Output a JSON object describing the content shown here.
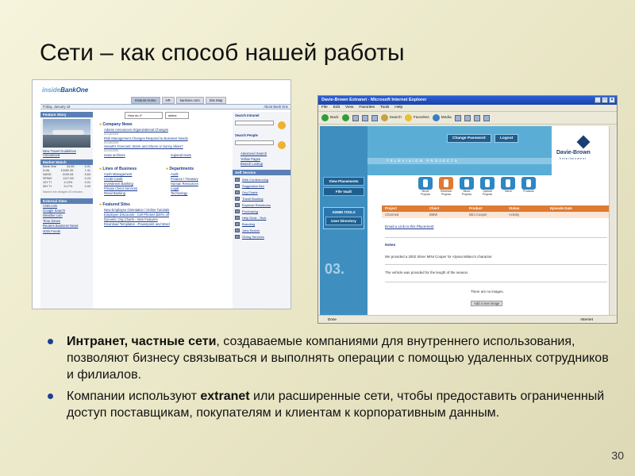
{
  "slide": {
    "title": "Сети – как способ нашей работы",
    "page_number": "30",
    "bullets": [
      {
        "bold": "Интранет, частные сети",
        "text": ", создаваемые компаниями для внутреннего использования,  позволяют бизнесу связываться и выполнять операции с помощью удаленных сотрудников и филиалов."
      },
      {
        "pre": "Компании используют ",
        "bold": "extranet",
        "text": " или расширенные сети, чтобы предоставить ограниченный доступ поставщикам, покупателям и клиентам к корпоративным данным."
      }
    ]
  },
  "intranet": {
    "logo_a": "inside",
    "logo_b": "BankOne",
    "tabs": [
      "Intranet Home",
      "HR",
      "bankone.com",
      "Site Map"
    ],
    "date": "Friday, January 19",
    "about": "About Bank One",
    "feature_story": "Feature Story",
    "feature_caption": "New Travel Guidelines Announced",
    "market_watch": "Market Watch",
    "market": [
      [
        "Bank One",
        "44.55",
        "0.01"
      ],
      [
        "DJIA",
        "10492.39",
        "7.41"
      ],
      [
        "NASD",
        "2100.84",
        "5.63"
      ],
      [
        "SP500",
        "1127.83",
        "0.23"
      ],
      [
        "10Y Tr",
        "4.10%",
        "0.01"
      ],
      [
        "30Y Tr",
        "5.17%",
        "0.00"
      ]
    ],
    "market_note": "Market info delayed 20 minutes",
    "external_sites": "External Sites",
    "external": [
      "CNN.com",
      "Google Search",
      "Weather.com",
      "Time Zones",
      "Reuters Business News",
      "401k Funds"
    ],
    "howdoi": "How do I?",
    "select": "select",
    "company_news": "Company News",
    "news": [
      {
        "t": "Adams Announces Organizational Changes",
        "d": "01/18/2005"
      },
      {
        "t": "Risk Management Changes Respond to Business Needs",
        "d": "01/18/2005"
      },
      {
        "t": "Seowk's Forecast: Storm and Gloom or Sunny Skies?",
        "d": "01/19/2005"
      }
    ],
    "news_archives": "news archives",
    "regional_news": "regional news",
    "lines_of_business": "Lines of Business",
    "lob": [
      "Cash Management",
      "Credit Cards",
      "Investment Banking",
      "Private Client Services",
      "Retail Banking"
    ],
    "departments": "Departments",
    "depts": [
      "Audit",
      "Finance / Treasury",
      "Human Resources",
      "Legal",
      "Technology"
    ],
    "featured_sites": "Featured Sites",
    "featured": [
      "New Employee Orientation / Online Tutorials",
      "Employee Discounts - Cell Phones $20% off",
      "Dynamic Org Charts - New Features",
      "Download Templates - Powerpoint and Word"
    ],
    "search_intranet": "Search Intranet",
    "search_people": "Search People",
    "people_links": [
      "Advanced Search",
      "Yellow Pages",
      "Branch Lookup"
    ],
    "self_service": "Self Service",
    "self": [
      "Web Conferencing",
      "Suggestion Box",
      "Org Charts",
      "Travel Booking",
      "Expense Reimburse",
      "Purchasing",
      "Help Desk - Tech",
      "Branding",
      "Jobs Search",
      "Giving Services"
    ]
  },
  "extranet": {
    "window_title": "Davie-Brown Extranet - Microsoft Internet Explorer",
    "menu": [
      "File",
      "Edit",
      "View",
      "Favorites",
      "Tools",
      "Help"
    ],
    "toolbar": [
      "Back",
      "Search",
      "Favorites",
      "Media"
    ],
    "change_password": "Change Password",
    "logout": "Logout",
    "brand": "Davie-Brown",
    "brand_sub": "entertainment",
    "track_text": "TELEVISION PROJECTS",
    "view_placements": "View Placements",
    "file_vault": "File Vault",
    "admin_tools": "ADMIN TOOLS",
    "user_directory": "User Directory",
    "big_number": "03.",
    "categories": [
      "Movie Projects",
      "Television Projects",
      "Music Projects",
      "Special Projects",
      "Talent",
      "Products"
    ],
    "columns": [
      "Project",
      "Client",
      "Product",
      "Status",
      "Episode Date"
    ],
    "row": [
      "Charmed",
      "BMW",
      "Mini Cooper",
      "Activity",
      ""
    ],
    "email_link": "Email a Link to this Placement",
    "notes_label": "Notes",
    "note1": "We provided a 2002 Silver MINI Cooper for Alyssa Milano's character.",
    "note2": "The vehicle was provided for the length of the season.",
    "no_images": "There are no images.",
    "add_image": "Add a new image",
    "status_done": "Done",
    "status_zone": "Internet"
  },
  "colors": {
    "accent": "#1f3f8f",
    "orange": "#e07a33",
    "blue": "#3e8fbf"
  }
}
